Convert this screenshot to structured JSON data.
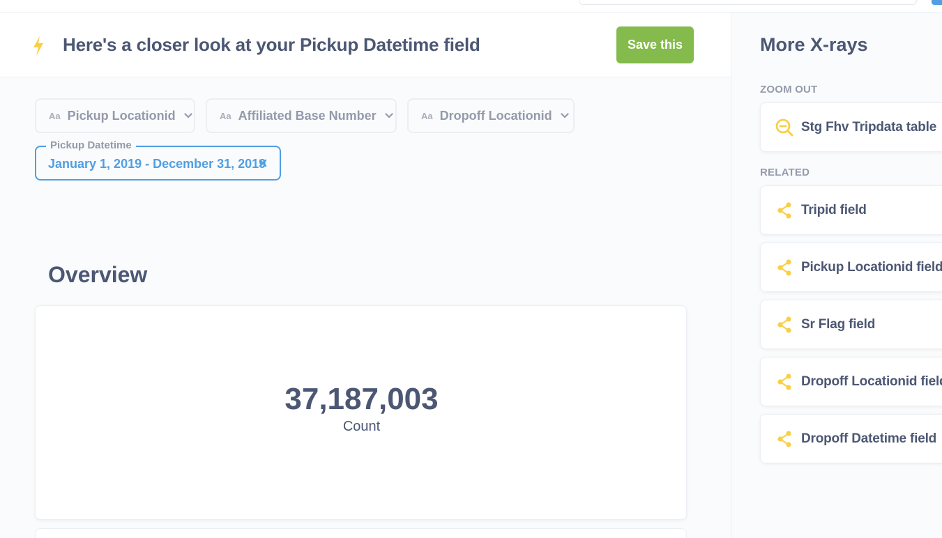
{
  "header": {
    "title": "Here's a closer look at your Pickup Datetime field",
    "save_label": "Save this"
  },
  "filters": [
    {
      "type_icon": "Aa",
      "label": "Pickup Locationid"
    },
    {
      "type_icon": "Aa",
      "label": "Affiliated Base Number"
    },
    {
      "type_icon": "Aa",
      "label": "Dropoff Locationid"
    }
  ],
  "active_filter": {
    "label": "Pickup Datetime",
    "value": "January 1, 2019 - December 31, 2019"
  },
  "overview": {
    "title": "Overview",
    "scalar_value": "37,187,003",
    "scalar_label": "Count"
  },
  "sidebar": {
    "title": "More X-rays",
    "zoom_out_label": "ZOOM OUT",
    "zoom_out_items": [
      {
        "label": "Stg Fhv Tripdata table",
        "icon": "zoom-out-icon"
      }
    ],
    "related_label": "RELATED",
    "related_items": [
      {
        "label": "Tripid field",
        "icon": "share-icon"
      },
      {
        "label": "Pickup Locationid field",
        "icon": "share-icon"
      },
      {
        "label": "Sr Flag field",
        "icon": "share-icon"
      },
      {
        "label": "Dropoff Locationid field",
        "icon": "share-icon"
      },
      {
        "label": "Dropoff Datetime field",
        "icon": "share-icon"
      }
    ]
  },
  "colors": {
    "accent": "#509ee3",
    "save_green": "#84bb4c",
    "icon_yellow": "#f9cf48",
    "text_dark": "#4c5773",
    "text_muted": "#949aab"
  }
}
